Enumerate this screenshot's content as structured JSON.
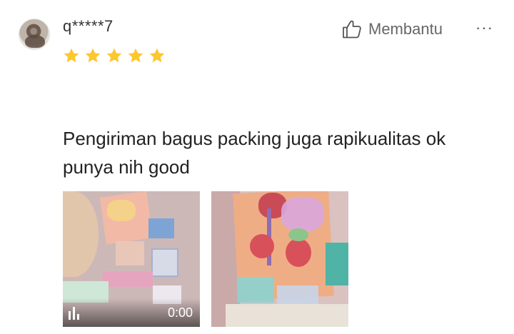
{
  "reviewer": {
    "username": "q*****7",
    "rating": 5
  },
  "actions": {
    "helpful_label": "Membantu",
    "more_label": "···"
  },
  "review": {
    "text": "Pengiriman bagus packing juga rapikualitas ok punya nih good"
  },
  "media": {
    "video": {
      "duration": "0:00"
    }
  },
  "colors": {
    "star": "#FDC72F",
    "text": "#222222",
    "muted": "#666666"
  },
  "icons": {
    "helpful": "thumbs-up-icon",
    "video": "video-bars-icon",
    "more": "more-options-icon"
  }
}
